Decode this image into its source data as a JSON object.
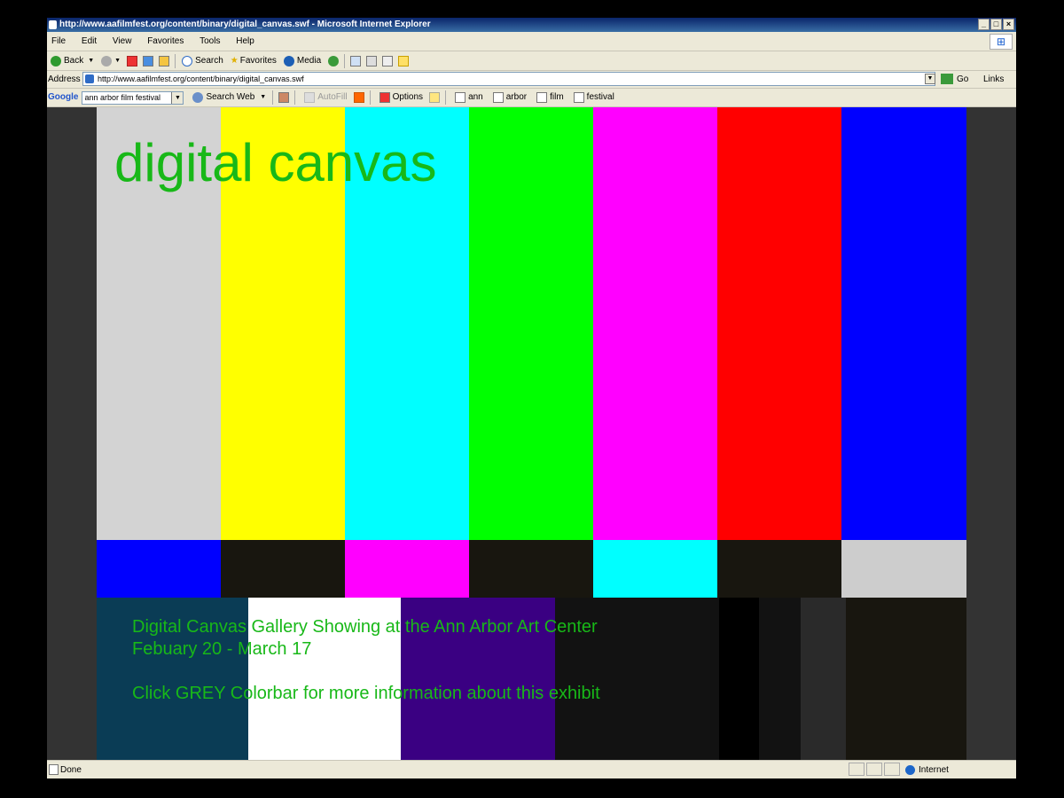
{
  "window": {
    "title": "http://www.aafilmfest.org/content/binary/digital_canvas.swf - Microsoft Internet Explorer"
  },
  "menu": [
    "File",
    "Edit",
    "View",
    "Favorites",
    "Tools",
    "Help"
  ],
  "toolbar": {
    "back": "Back",
    "search": "Search",
    "favorites": "Favorites",
    "media": "Media"
  },
  "address": {
    "label": "Address",
    "url": "http://www.aafilmfest.org/content/binary/digital_canvas.swf",
    "go": "Go",
    "links": "Links"
  },
  "google": {
    "logo": "Google",
    "query": "ann arbor film festival",
    "search_web": "Search Web",
    "autofill": "AutoFill",
    "options": "Options",
    "terms": [
      "ann",
      "arbor",
      "film",
      "festival"
    ]
  },
  "page": {
    "heading": "digital canvas",
    "line1": "Digital Canvas Gallery Showing at the Ann Arbor Art Center",
    "line2": "Febuary 20 - March 17",
    "line3": "Click GREY Colorbar for more information about this exhibit"
  },
  "colorbars": {
    "top": [
      "#d3d3d3",
      "#ffff00",
      "#00ffff",
      "#00ff00",
      "#ff00ff",
      "#ff0000",
      "#0000ff"
    ],
    "middle": [
      "#0000ff",
      "#18160f",
      "#ff00ff",
      "#18160f",
      "#00ffff",
      "#18160f",
      "#cdcdcd"
    ],
    "bottom": [
      "#0a3c55",
      "#ffffff",
      "#3a0082",
      "#121212",
      "#000000",
      "#121212",
      "#2a2a2a",
      "#18160f"
    ]
  },
  "status": {
    "text": "Done",
    "zone": "Internet"
  }
}
